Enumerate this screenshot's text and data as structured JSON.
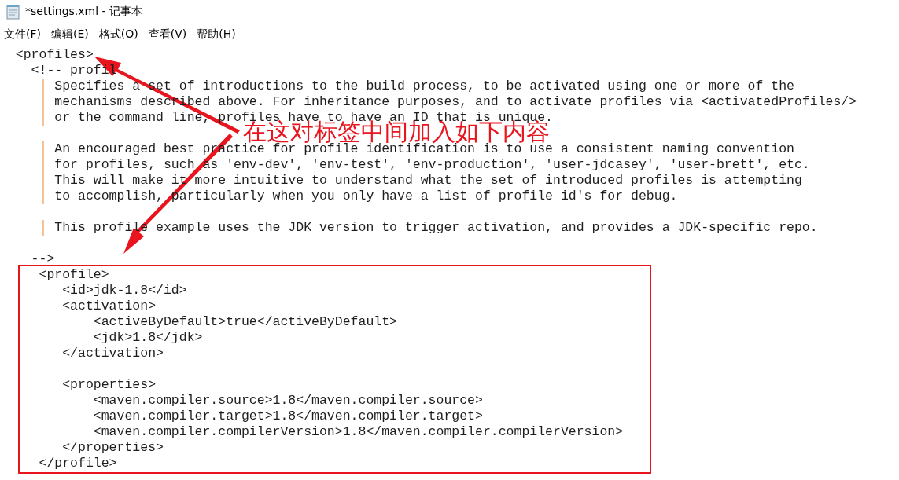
{
  "window": {
    "title": "*settings.xml - 记事本"
  },
  "menu": [
    "文件(F)",
    "编辑(E)",
    "格式(O)",
    "查看(V)",
    "帮助(H)"
  ],
  "editor": {
    "paragraphs": [
      {
        "lines": [
          {
            "text": "  <profiles>",
            "comment_body": false
          },
          {
            "text": "    <!-- profil",
            "comment_body": false
          },
          {
            "text": "       Specifies a set of introductions to the build process, to be activated using one or more of the",
            "comment_body": true
          },
          {
            "text": "       mechanisms described above. For inheritance purposes, and to activate profiles via <activatedProfiles/>",
            "comment_body": true
          },
          {
            "text": "       or the command line, profiles have to have an ID that is unique.",
            "comment_body": true
          }
        ]
      },
      {
        "lines": [
          {
            "text": "       An encouraged best practice for profile identification is to use a consistent naming convention",
            "comment_body": true
          },
          {
            "text": "       for profiles, such as 'env-dev', 'env-test', 'env-production', 'user-jdcasey', 'user-brett', etc.",
            "comment_body": true
          },
          {
            "text": "       This will make it more intuitive to understand what the set of introduced profiles is attempting",
            "comment_body": true
          },
          {
            "text": "       to accomplish, particularly when you only have a list of profile id's for debug.",
            "comment_body": true
          }
        ]
      },
      {
        "lines": [
          {
            "text": "       This profile example uses the JDK version to trigger activation, and provides a JDK-specific repo.",
            "comment_body": true
          }
        ]
      },
      {
        "lines": [
          {
            "text": "    -->",
            "comment_body": false
          }
        ]
      }
    ],
    "boxed_paragraphs": [
      {
        "lines": [
          "     <profile>",
          "        <id>jdk-1.8</id>",
          "        <activation>",
          "            <activeByDefault>true</activeByDefault>",
          "            <jdk>1.8</jdk>",
          "        </activation>"
        ]
      },
      {
        "lines": [
          "        <properties>",
          "            <maven.compiler.source>1.8</maven.compiler.source>",
          "            <maven.compiler.target>1.8</maven.compiler.target>",
          "            <maven.compiler.compilerVersion>1.8</maven.compiler.compilerVersion>",
          "        </properties>",
          "     </profile>"
        ]
      }
    ]
  },
  "annotation": {
    "text": "在这对标签中间加入如下内容"
  }
}
